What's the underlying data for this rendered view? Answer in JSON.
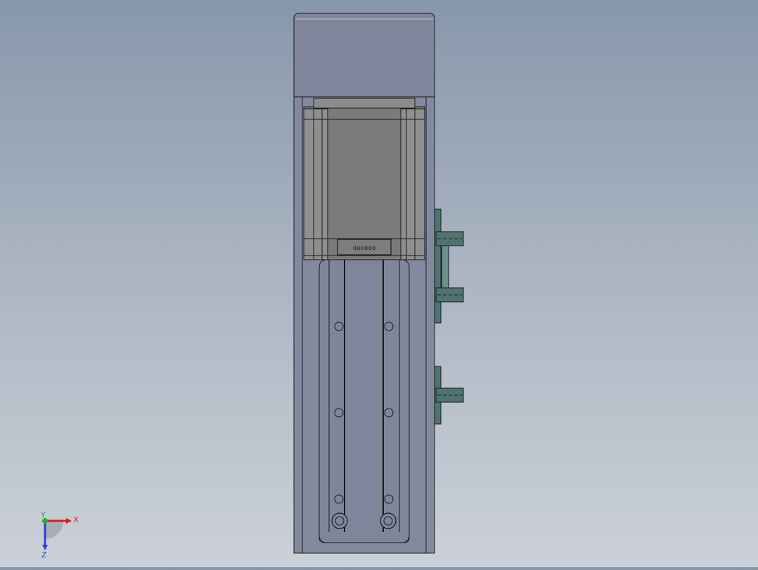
{
  "viewport": {
    "background_top": "#8797ab",
    "background_bottom": "#ccd1d8"
  },
  "model": {
    "motor_cap_color": "#7f869b",
    "motor_body_color": "#7b7b7b",
    "base_plate_color": "#838aa0",
    "rail_color": "#7f869b",
    "bracket_color": "#4f7371",
    "line_color": "#1a1a1a",
    "connector_label": "oooooo"
  },
  "triad": {
    "x_label": "X",
    "y_label": "Y",
    "z_label": "Z",
    "x_color": "#d81e1e",
    "y_color": "#1fae33",
    "z_color": "#2b3fd1"
  }
}
